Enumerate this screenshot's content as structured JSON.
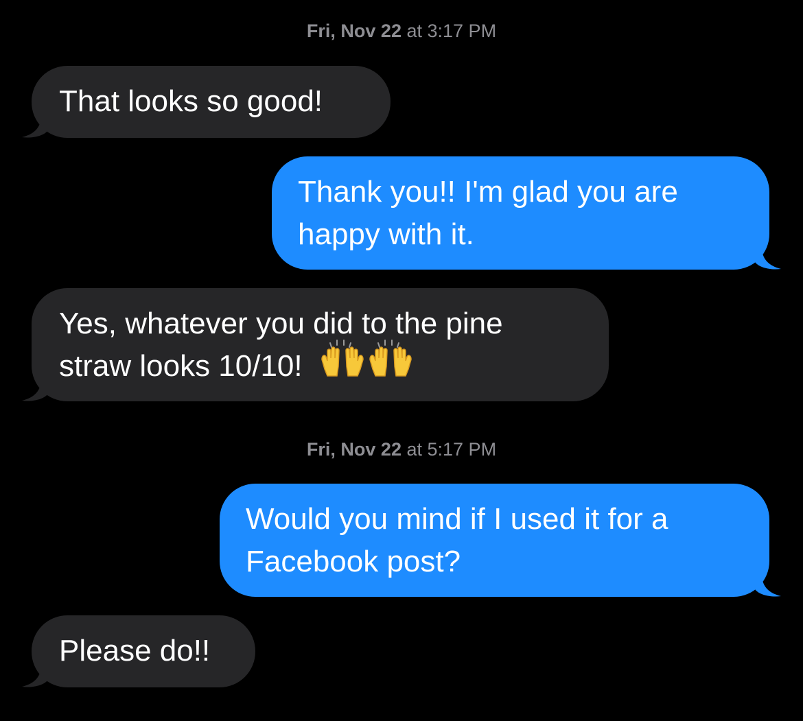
{
  "conversation": {
    "header_1": {
      "day": "Fri, Nov 22",
      "time": "at 3:17 PM"
    },
    "header_2": {
      "day": "Fri, Nov 22",
      "time": "at 5:17 PM"
    },
    "messages": [
      {
        "from": "received",
        "lines": [
          "That looks so good!"
        ]
      },
      {
        "from": "sent",
        "lines": [
          "Thank you!! I'm glad you are",
          "happy with it."
        ]
      },
      {
        "from": "received",
        "lines": [
          "Yes, whatever you did to the pine",
          "straw looks 10/10!"
        ],
        "emoji": "raising-hands-icon x2"
      },
      {
        "from": "sent",
        "lines": [
          "Would you mind if I used it for a",
          "Facebook post?"
        ]
      },
      {
        "from": "received",
        "lines": [
          "Please do!!"
        ]
      }
    ]
  },
  "colors": {
    "background": "#000000",
    "received_bubble": "#262628",
    "sent_bubble": "#1e8cff",
    "timestamp_text": "#8e8e93"
  }
}
